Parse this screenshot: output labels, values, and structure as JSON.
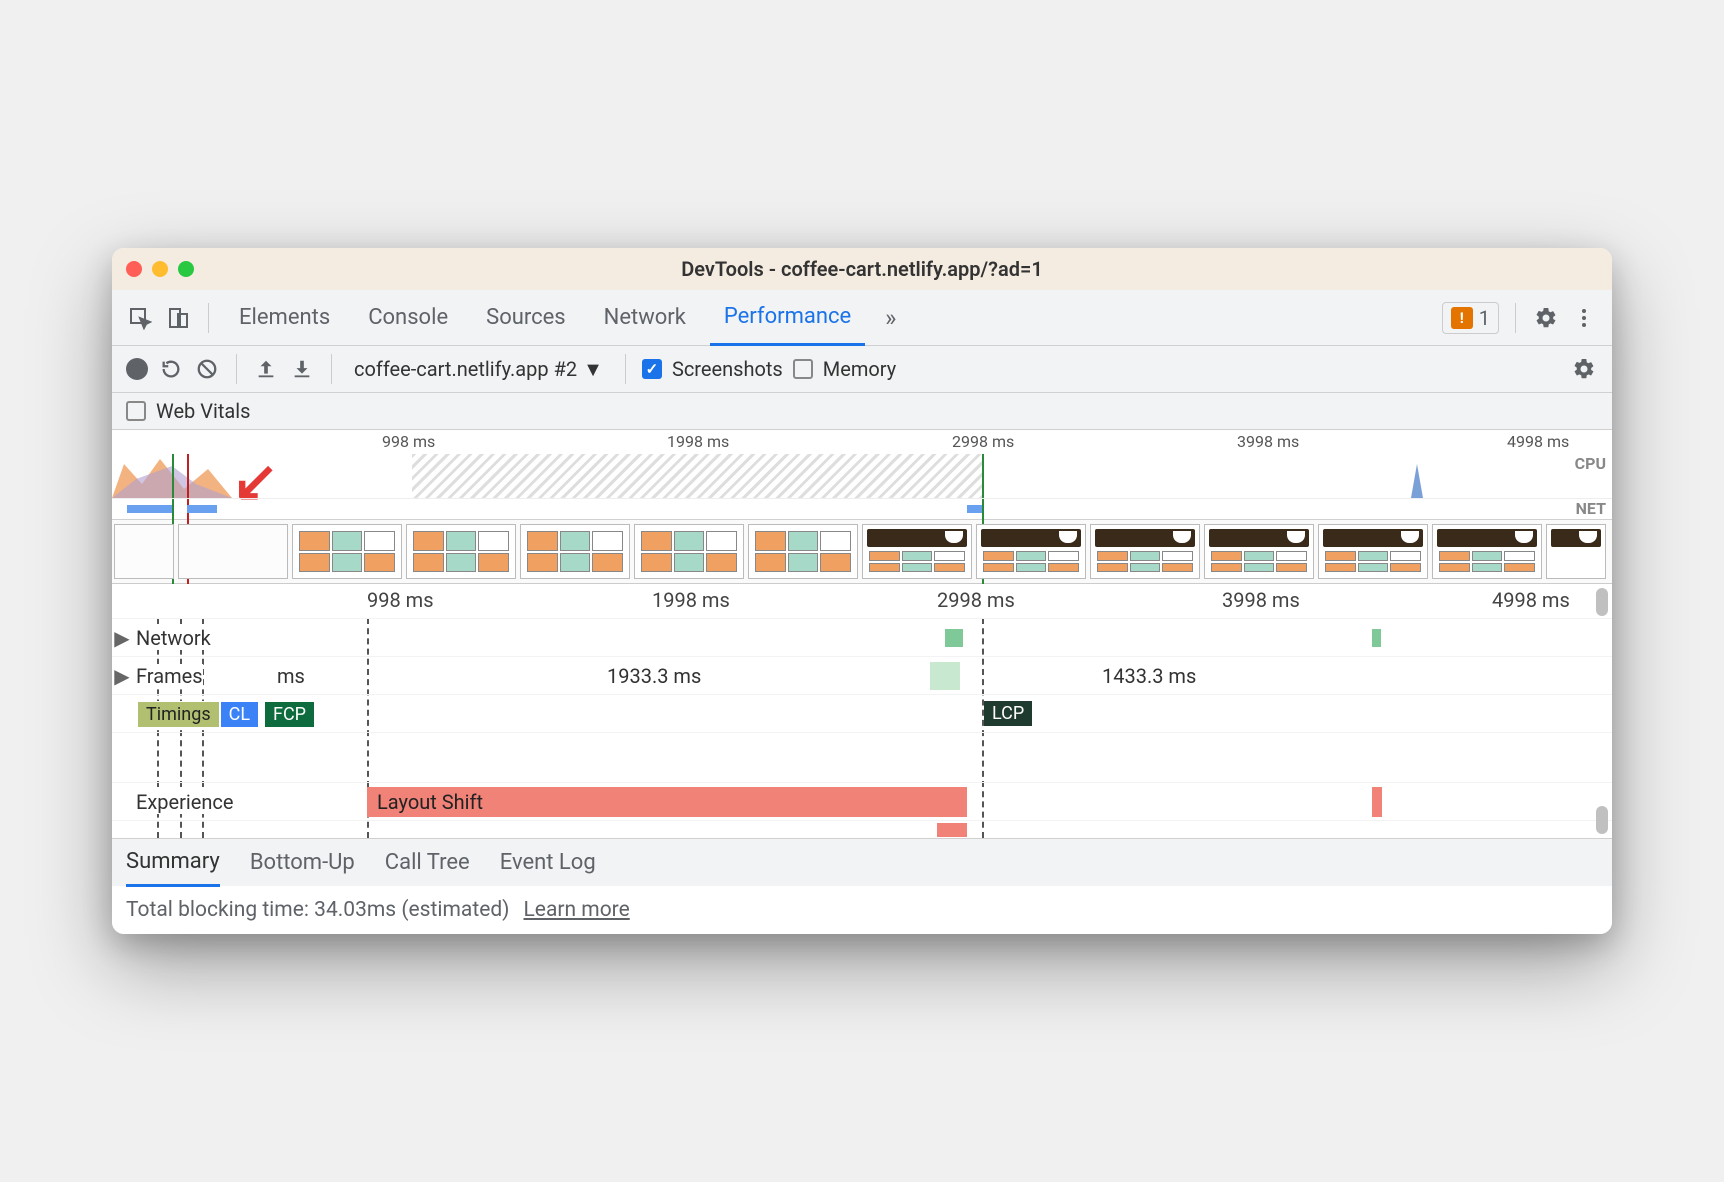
{
  "window": {
    "title": "DevTools - coffee-cart.netlify.app/?ad=1"
  },
  "tabs": {
    "elements": "Elements",
    "console": "Console",
    "sources": "Sources",
    "network": "Network",
    "performance": "Performance",
    "issues_count": "1"
  },
  "toolbar": {
    "recording_dropdown": "coffee-cart.netlify.app #2",
    "screenshots_label": "Screenshots",
    "memory_label": "Memory"
  },
  "toolbar2": {
    "web_vitals_label": "Web Vitals"
  },
  "overview_ruler": [
    "998 ms",
    "1998 ms",
    "2998 ms",
    "3998 ms",
    "4998 ms"
  ],
  "overview_labels": {
    "cpu": "CPU",
    "net": "NET"
  },
  "main_ruler": [
    "998 ms",
    "1998 ms",
    "2998 ms",
    "3998 ms",
    "4998 ms"
  ],
  "tracks": {
    "network": "Network",
    "frames": "Frames",
    "frame_times": [
      "ms",
      "1933.3 ms",
      "1433.3 ms"
    ],
    "timings": "Timings",
    "timings_badges": {
      "cl": "CL",
      "fcp": "FCP",
      "lcp": "LCP"
    },
    "experience": "Experience",
    "layout_shift": "Layout Shift"
  },
  "bottom_tabs": {
    "summary": "Summary",
    "bottom_up": "Bottom-Up",
    "call_tree": "Call Tree",
    "event_log": "Event Log"
  },
  "status": {
    "blocking_time": "Total blocking time: 34.03ms (estimated)",
    "learn_more": "Learn more"
  }
}
